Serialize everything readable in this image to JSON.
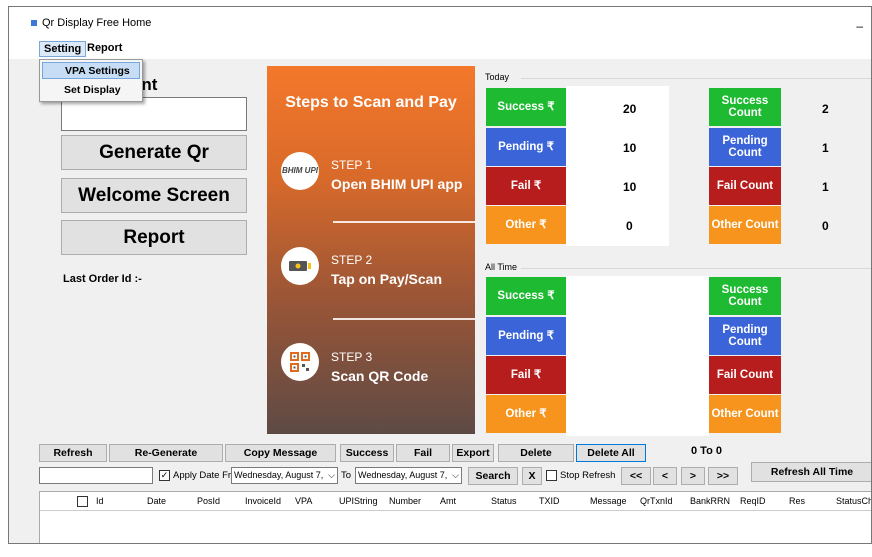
{
  "window": {
    "title": "Qr Display Free Home",
    "minimize": "–"
  },
  "menu": {
    "setting": "Setting",
    "report": "Report",
    "dropdown": [
      "VPA Settings",
      "Set Display"
    ]
  },
  "left": {
    "partial_label": "unt",
    "amount_value": "",
    "generate": "Generate Qr",
    "welcome": "Welcome Screen",
    "report": "Report",
    "last_order": "Last Order Id :-"
  },
  "steps": {
    "title": "Steps to Scan and Pay",
    "items": [
      {
        "num": "STEP 1",
        "text": "Open BHIM UPI app",
        "icon_label": "BHIM UPI"
      },
      {
        "num": "STEP 2",
        "text": "Tap on Pay/Scan",
        "icon_label": ""
      },
      {
        "num": "STEP 3",
        "text": "Scan QR Code",
        "icon_label": ""
      }
    ]
  },
  "today": {
    "label": "Today",
    "amounts": [
      {
        "label": "Success ₹",
        "value": "20"
      },
      {
        "label": "Pending ₹",
        "value": "10"
      },
      {
        "label": "Fail   ₹",
        "value": "10"
      },
      {
        "label": "Other  ₹",
        "value": "0"
      }
    ],
    "counts": [
      {
        "label": "Success Count",
        "value": "2"
      },
      {
        "label": "Pending Count",
        "value": "1"
      },
      {
        "label": "Fail Count",
        "value": "1"
      },
      {
        "label": "Other Count",
        "value": "0"
      }
    ]
  },
  "alltime": {
    "label": "All Time",
    "amounts": [
      {
        "label": "Success ₹"
      },
      {
        "label": "Pending ₹"
      },
      {
        "label": "Fail   ₹"
      },
      {
        "label": "Other  ₹"
      }
    ],
    "counts": [
      {
        "label": "Success Count"
      },
      {
        "label": "Pending Count"
      },
      {
        "label": "Fail Count"
      },
      {
        "label": "Other Count"
      }
    ]
  },
  "toolbar": {
    "refresh": "Refresh",
    "regenerate": "Re-Generate",
    "copy": "Copy Message",
    "success": "Success",
    "fail": "Fail",
    "export": "Export",
    "delete": "Delete",
    "delete_all": "Delete All",
    "range": "0 To 0",
    "refresh_all": "Refresh All Time"
  },
  "filter": {
    "search_value": "",
    "apply_date": "Apply Date From",
    "from_date": "Wednesday,    August     7,",
    "to_label": "To",
    "to_date": "Wednesday,    August     7,",
    "search": "Search",
    "x": "X",
    "stop_refresh": "Stop Refresh",
    "first": "<<",
    "prev": "<",
    "next": ">",
    "last": ">>"
  },
  "grid": {
    "columns": [
      "Id",
      "Date",
      "PosId",
      "InvoiceId",
      "VPA",
      "UPIString",
      "Number",
      "Amt",
      "Status",
      "TXID",
      "Message",
      "QrTxnId",
      "BankRRN",
      "ReqID",
      "Res",
      "StatusCh"
    ]
  },
  "colors": {
    "success": "#1dba32",
    "pending": "#3b64d8",
    "fail": "#b81d1d",
    "other": "#f7941d",
    "steps_orange": "#f3782b"
  }
}
